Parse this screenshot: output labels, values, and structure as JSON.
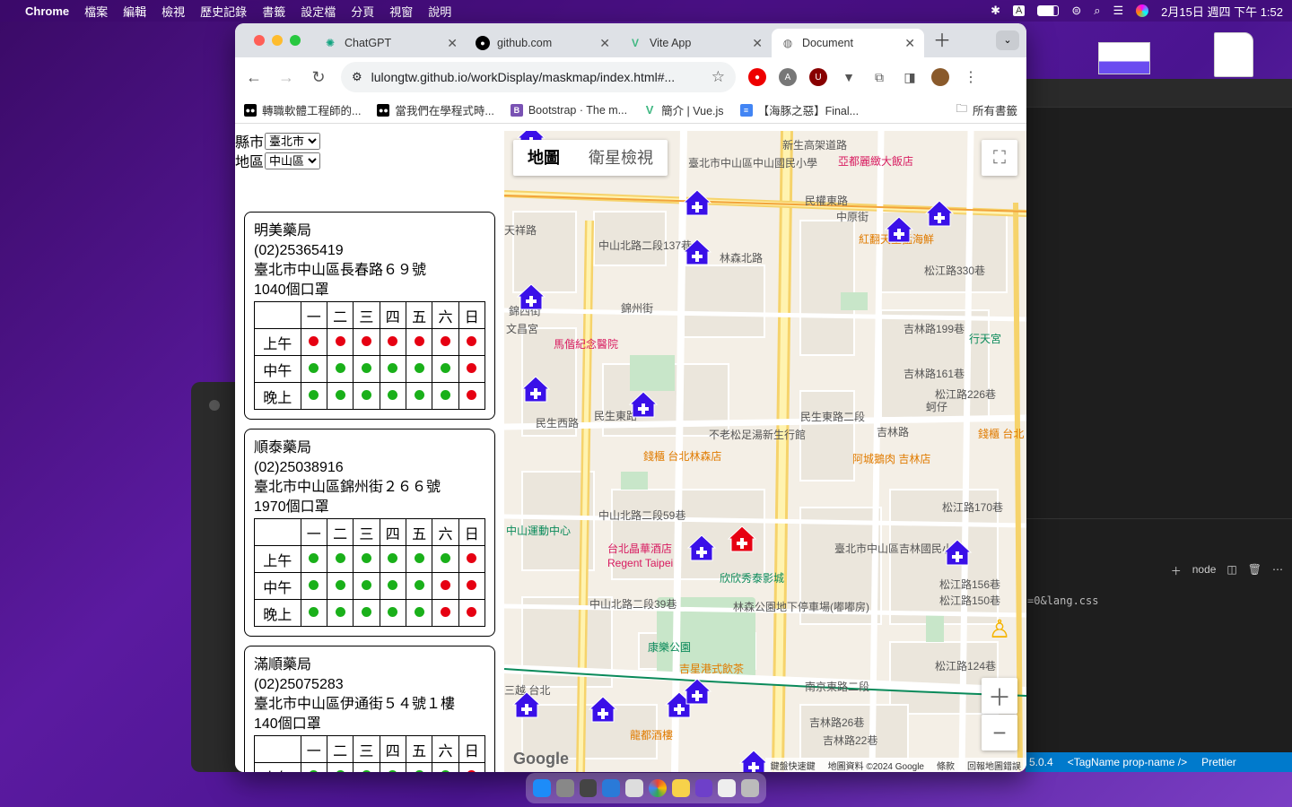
{
  "menubar": {
    "app": "Chrome",
    "items": [
      "檔案",
      "編輯",
      "檢視",
      "歷史記錄",
      "書籤",
      "設定檔",
      "分頁",
      "視窗",
      "說明"
    ],
    "clock": "2月15日 週四 下午 1:52"
  },
  "chrome": {
    "tabs": [
      {
        "label": "ChatGPT",
        "icon": "chatgpt-icon"
      },
      {
        "label": "github.com",
        "icon": "github-icon"
      },
      {
        "label": "Vite App",
        "icon": "vue-icon"
      },
      {
        "label": "Document",
        "icon": "globe-icon",
        "active": true
      }
    ],
    "url": "lulongtw.github.io/workDisplay/maskmap/index.html#...",
    "bookmarks": [
      {
        "label": "轉職軟體工程師的...",
        "icon": "medium-icon"
      },
      {
        "label": "當我們在學程式時...",
        "icon": "medium-icon"
      },
      {
        "label": "Bootstrap · The m...",
        "icon": "bootstrap-icon"
      },
      {
        "label": "簡介 | Vue.js",
        "icon": "vue-icon"
      },
      {
        "label": "【海豚之惡】Final...",
        "icon": "doc-icon"
      }
    ],
    "all_bookmarks": "所有書籤"
  },
  "filters": {
    "county_label": "縣市",
    "county_value": "臺北市",
    "district_label": "地區",
    "district_value": "中山區"
  },
  "schedule_headers": [
    "一",
    "二",
    "三",
    "四",
    "五",
    "六",
    "日"
  ],
  "schedule_rows": [
    "上午",
    "中午",
    "晚上"
  ],
  "colors": {
    "open": "#1ab01a",
    "closed": "#e60012",
    "marker": "#3a10e8"
  },
  "pharmacies": [
    {
      "name": "明美藥局",
      "phone": "(02)25365419",
      "address": "臺北市中山區長春路６９號",
      "masks": "1040個口罩",
      "schedule": [
        [
          "closed",
          "closed",
          "closed",
          "closed",
          "closed",
          "closed",
          "closed"
        ],
        [
          "open",
          "open",
          "open",
          "open",
          "open",
          "open",
          "closed"
        ],
        [
          "open",
          "open",
          "open",
          "open",
          "open",
          "open",
          "closed"
        ]
      ]
    },
    {
      "name": "順泰藥局",
      "phone": "(02)25038916",
      "address": "臺北市中山區錦州街２６６號",
      "masks": "1970個口罩",
      "schedule": [
        [
          "open",
          "open",
          "open",
          "open",
          "open",
          "open",
          "closed"
        ],
        [
          "open",
          "open",
          "open",
          "open",
          "open",
          "closed",
          "closed"
        ],
        [
          "open",
          "open",
          "open",
          "open",
          "open",
          "closed",
          "closed"
        ]
      ]
    },
    {
      "name": "滿順藥局",
      "phone": "(02)25075283",
      "address": "臺北市中山區伊通街５４號１樓",
      "masks": "140個口罩",
      "schedule": [
        [
          "open",
          "open",
          "open",
          "open",
          "open",
          "open",
          "closed"
        ]
      ]
    }
  ],
  "map": {
    "type_map": "地圖",
    "type_satellite": "衛星檢視",
    "attribution": [
      "鍵盤快速鍵",
      "地圖資料 ©2024 Google",
      "條款",
      "回報地圖錯誤"
    ],
    "logo": "Google",
    "labels": [
      "臺北市中山區中山國民小學",
      "民權東路",
      "亞都麗緻大飯店",
      "紅翻天生猛海鮮",
      "中山北路二段137巷",
      "林森北路",
      "松江路330巷",
      "錦西街",
      "錦州街",
      "吉林路199巷",
      "行天宮",
      "文昌宮",
      "馬偕紀念醫院",
      "吉林路161巷",
      "松江路226巷",
      "民生東路二段",
      "民生西路",
      "民生東路",
      "不老松足湯新生行館",
      "蚵仔",
      "錢櫃 台北林森店",
      "阿城鵝肉 吉林店",
      "錢櫃 台北",
      "中山運動中心",
      "中山北路二段59巷",
      "松江路170巷",
      "台北晶華酒店",
      "Regent Taipei",
      "欣欣秀泰影城",
      "臺北市中山區吉林國民小學",
      "松江路156巷",
      "松江路150巷",
      "林森公園地下停車場(嘟嘟房)",
      "中山北路二段39巷",
      "康樂公園",
      "吉星港式飲茶",
      "松江路124巷",
      "南京東路二段",
      "龍都酒樓",
      "三越 台北",
      "吉林路26巷",
      "吉林路22巷",
      "新生高架道路",
      "中原街",
      "吉林路",
      "天祥路"
    ],
    "pharmacy_markers": 16,
    "selected_marker": 1
  },
  "vscode": {
    "status": [
      "5.0.4",
      "<TagName prop-name />",
      "Prettier"
    ],
    "terminal": "node",
    "terminal_text": "=0&lang.css"
  }
}
